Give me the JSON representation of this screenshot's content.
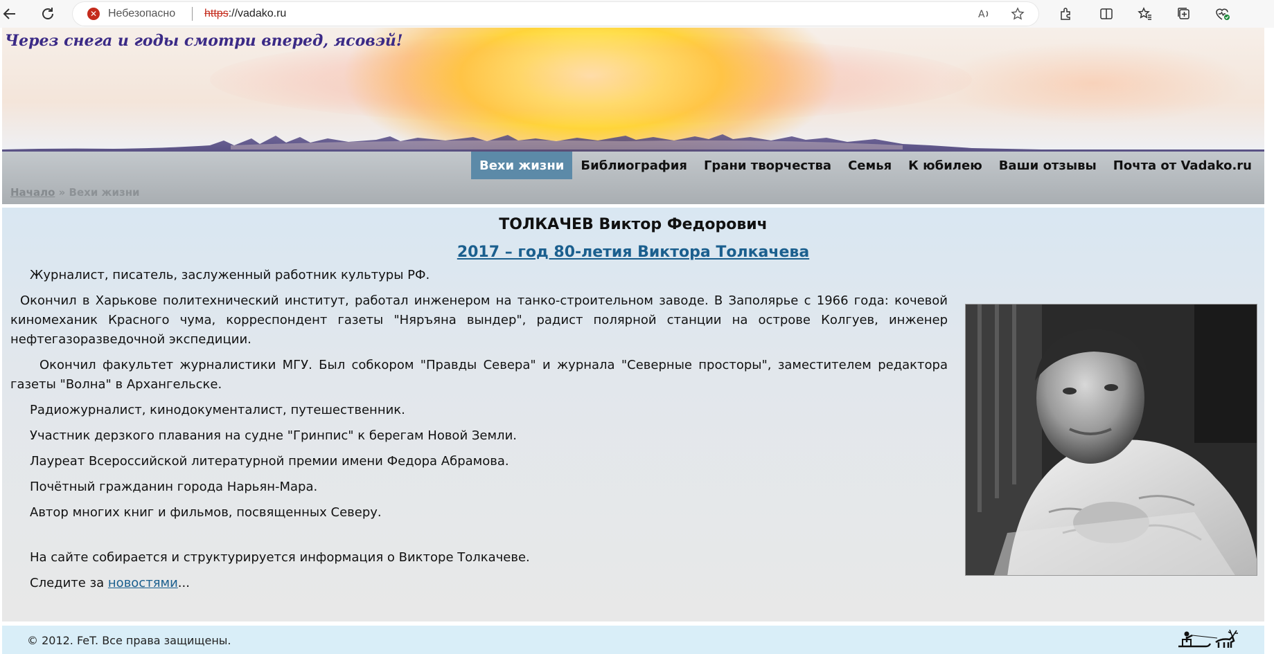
{
  "browser": {
    "security_label": "Небезопасно",
    "url_protocol": "https",
    "url_rest": "://vadako.ru"
  },
  "header": {
    "slogan": "Через снега и годы смотри вперед, ясовэй!"
  },
  "menu": {
    "items": [
      {
        "label": "Вехи жизни",
        "active": true
      },
      {
        "label": "Библиография"
      },
      {
        "label": "Грани творчества"
      },
      {
        "label": "Семья"
      },
      {
        "label": "К юбилею"
      },
      {
        "label": "Ваши отзывы"
      },
      {
        "label": "Почта от Vadako.ru"
      }
    ]
  },
  "breadcrumb": {
    "home": "Начало",
    "separator": " » ",
    "current": "Вехи жизни"
  },
  "main": {
    "title": "ТОЛКАЧЕВ Виктор Федорович",
    "jubilee_link": "2017 – год 80-летия Виктора Толкачева",
    "paragraphs": [
      "Журналист, писатель, заслуженный работник культуры РФ.",
      "Окончил в Харькове политехнический институт, работал инженером на танко-строительном заводе. В Заполярье с 1966 года: кочевой киномеханик Красного чума, корреспондент газеты \"Няръяна вындер\", радист полярной станции на острове Колгуев, инженер нефтегазоразведочной экспедиции.",
      "Окончил факультет журналистики МГУ. Был собкором \"Правды Севера\" и журнала \"Северные просторы\", заместителем редактора газеты \"Волна\" в Архангельске.",
      "Радиожурналист, кинодокументалист, путешественник.",
      "Участник дерзкого плавания на судне \"Гринпис\" к берегам Новой Земли.",
      "Лауреат Всероссийской литературной премии имени Федора  Абрамова.",
      "Почётный гражданин города Нарьян-Мара.",
      "Автор многих книг и фильмов, посвященных Северу.",
      "На сайте собирается и структурируется информация о Викторе Толкачеве."
    ],
    "follow_prefix": "Следите за ",
    "follow_link": "новостями",
    "follow_suffix": "..."
  },
  "footer": {
    "copyright": "© 2012. FeT. Все права защищены."
  }
}
